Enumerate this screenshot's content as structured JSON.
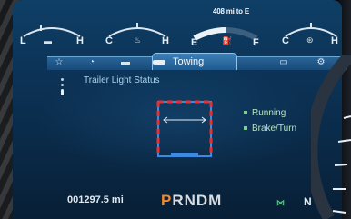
{
  "gauges": [
    {
      "left_label": "L",
      "right_label": "H",
      "icon": "oil-temp-icon"
    },
    {
      "left_label": "C",
      "right_label": "H",
      "icon": "coolant-temp-icon"
    },
    {
      "left_label": "E",
      "right_label": "F",
      "icon": "fuel-pump-icon",
      "level": 0.5
    },
    {
      "left_label": "C",
      "right_label": "H",
      "icon": "transmission-temp-icon"
    }
  ],
  "range_text": "408 mi to E",
  "tabs": [
    {
      "icon": "star-icon",
      "glyph": "☆"
    },
    {
      "icon": "gauge-icon",
      "glyph": "◔"
    },
    {
      "icon": "vehicle-icon",
      "glyph": "▬"
    },
    {
      "icon": "trailer-icon",
      "label": "Towing",
      "active": true
    },
    {
      "icon": "truck-icon",
      "glyph": "▭"
    },
    {
      "icon": "wrench-icon",
      "glyph": "⚙"
    }
  ],
  "trailer_light": {
    "title": "Trailer Light Status",
    "legend": [
      {
        "label": "Running",
        "color": "#7cd08c"
      },
      {
        "label": "Brake/Turn",
        "color": "#7cd08c"
      }
    ]
  },
  "odometer": "001297.5 mi",
  "odometer_sub": "",
  "gear": {
    "selected": "P",
    "rest": "RNDM"
  },
  "transmission": {
    "icon": "tow-haul-icon",
    "glyph": "⋈",
    "gear": "N"
  },
  "colors": {
    "accent": "#2a6598",
    "gear_selected": "#f08a2c",
    "trailer_red": "#e53232",
    "trailer_blue": "#3c8be0"
  }
}
